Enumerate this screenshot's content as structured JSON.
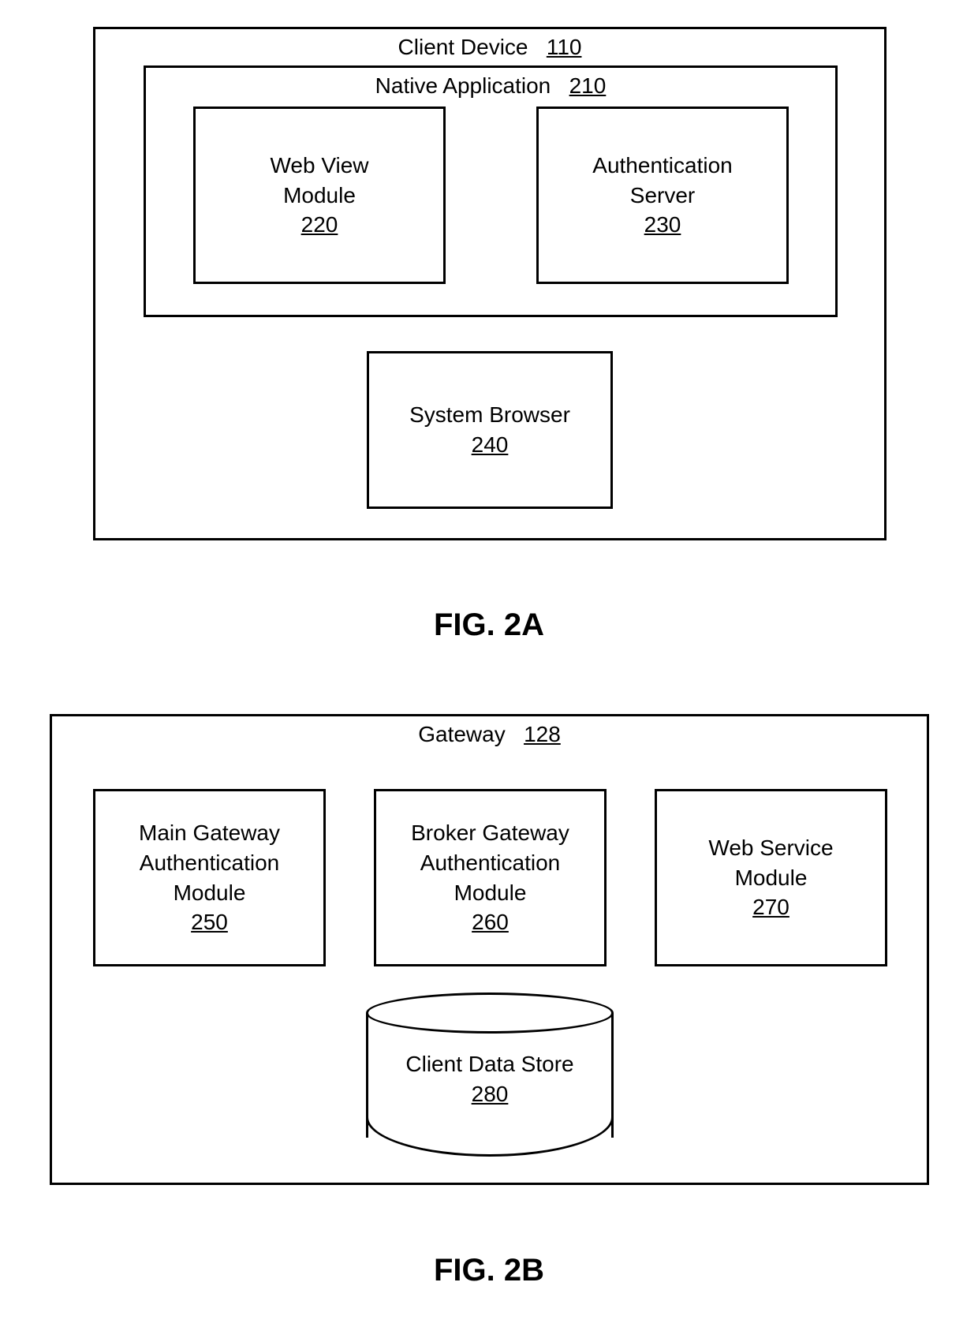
{
  "figA": {
    "clientDevice": {
      "label": "Client Device",
      "ref": "110"
    },
    "nativeApp": {
      "label": "Native Application",
      "ref": "210"
    },
    "webView": {
      "line1": "Web View",
      "line2": "Module",
      "ref": "220"
    },
    "authServer": {
      "line1": "Authentication",
      "line2": "Server",
      "ref": "230"
    },
    "sysBrowser": {
      "label": "System Browser",
      "ref": "240"
    },
    "caption": "FIG. 2A"
  },
  "figB": {
    "gateway": {
      "label": "Gateway",
      "ref": "128"
    },
    "mainGw": {
      "line1": "Main Gateway",
      "line2": "Authentication",
      "line3": "Module",
      "ref": "250"
    },
    "brokerGw": {
      "line1": "Broker Gateway",
      "line2": "Authentication",
      "line3": "Module",
      "ref": "260"
    },
    "webSvc": {
      "line1": "Web Service",
      "line2": "Module",
      "ref": "270"
    },
    "dataStore": {
      "label": "Client Data Store",
      "ref": "280"
    },
    "caption": "FIG. 2B"
  }
}
